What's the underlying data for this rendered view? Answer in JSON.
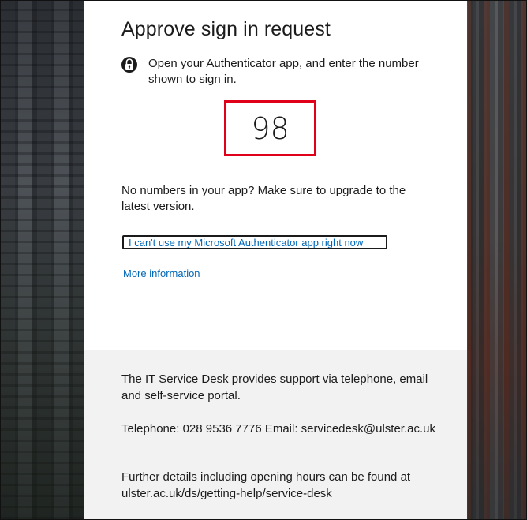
{
  "page": {
    "title": "Approve sign in request",
    "instruction": "Open your Authenticator app, and enter the number shown to sign in.",
    "sign_in_number": "98",
    "no_numbers_note": "No numbers in your app? Make sure to upgrade to the latest version.",
    "alt_link": "I can't use my Microsoft Authenticator app right now",
    "more_info_link": "More information"
  },
  "footer": {
    "support_text": "The IT Service Desk provides support via telephone, email and self-service portal.",
    "contact_text": "Telephone: 028 9536 7776 Email: servicedesk@ulster.ac.uk",
    "details_text": "Further details including opening hours can be found at ulster.ac.uk/ds/getting-help/service-desk"
  },
  "icons": {
    "lock": "lock-icon"
  },
  "colors": {
    "link": "#0067b8",
    "highlight_box": "#e0001a",
    "footer_bg": "#f2f2f2"
  }
}
